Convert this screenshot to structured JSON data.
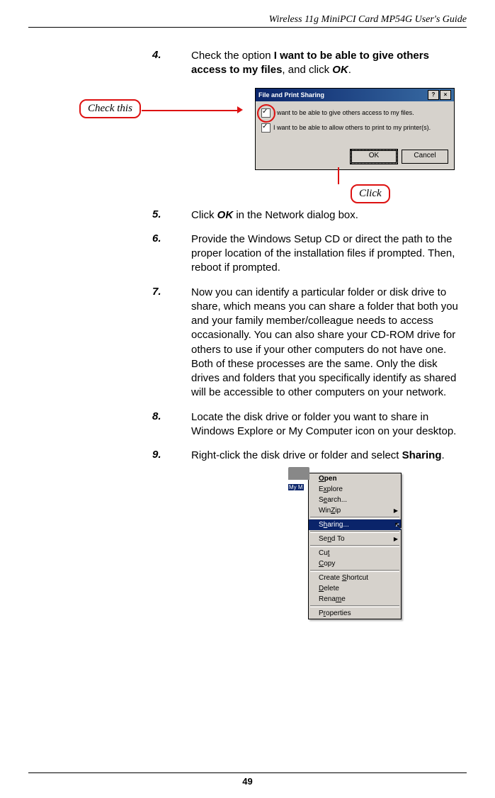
{
  "header": {
    "title": "Wireless 11g MiniPCI Card MP54G User's Guide"
  },
  "callouts": {
    "check_this": "Check this",
    "click": "Click"
  },
  "steps": {
    "s4": {
      "num": "4.",
      "prefix": "Check the option ",
      "bold1": "I want to be able to give others access to my files",
      "mid": ", and click ",
      "bold2": "OK",
      "suffix": "."
    },
    "s5": {
      "num": "5.",
      "prefix": "Click ",
      "bold": "OK",
      "suffix": " in the Network dialog box."
    },
    "s6": {
      "num": "6.",
      "text": "Provide the Windows Setup CD or direct the path to the proper location of the installation files if prompted.  Then, reboot if prompted."
    },
    "s7": {
      "num": "7.",
      "text": "Now you can identify a particular folder or disk drive to share, which means you can share a folder that both you and your family member/colleague needs to access occasionally.  You can also share your CD-ROM drive for others to use if your other computers do not have one.  Both of these processes are the same.  Only the disk drives and folders that you specifically identify as shared will be accessible to other computers on your network."
    },
    "s8": {
      "num": "8.",
      "text": "Locate the disk drive or folder you want to share in Windows Explore or My Computer icon on your desktop."
    },
    "s9": {
      "num": "9.",
      "prefix": "Right-click the disk drive or folder and select ",
      "bold": "Sharing",
      "suffix": "."
    }
  },
  "dialog": {
    "title": "File and Print Sharing",
    "help_btn": "?",
    "close_btn": "×",
    "opt1": "I want to be able to give others access to my files.",
    "opt2": "I want to be able to allow others to print to my printer(s).",
    "ok": "OK",
    "cancel": "Cancel"
  },
  "context_menu": {
    "folder_label": "My M",
    "items": {
      "open": "Open",
      "explore": "Explore",
      "search": "Search...",
      "winzip": "WinZip",
      "sharing": "Sharing...",
      "sendto": "Send To",
      "cut": "Cut",
      "copy": "Copy",
      "shortcut": "Create Shortcut",
      "delete": "Delete",
      "rename": "Rename",
      "properties": "Properties"
    }
  },
  "page_number": "49"
}
